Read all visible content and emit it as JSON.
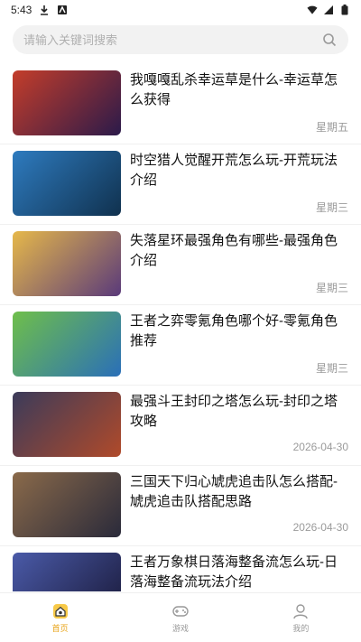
{
  "status_bar": {
    "time": "5:43"
  },
  "search": {
    "placeholder": "请输入关键词搜索"
  },
  "articles": [
    {
      "title": "我嘎嘎乱杀幸运草是什么-幸运草怎么获得",
      "date": "星期五",
      "thumb_label": "",
      "thumb_colors": [
        "#c43d2a",
        "#2b1a4a"
      ]
    },
    {
      "title": "时空猎人觉醒开荒怎么玩-开荒玩法介绍",
      "date": "星期三",
      "thumb_label": "",
      "thumb_colors": [
        "#2e7bbf",
        "#10314e"
      ]
    },
    {
      "title": "失落星环最强角色有哪些-最强角色介绍",
      "date": "星期三",
      "thumb_label": "",
      "thumb_colors": [
        "#e6b84a",
        "#5a3a7a"
      ]
    },
    {
      "title": "王者之弈零氪角色哪个好-零氪角色推荐",
      "date": "星期三",
      "thumb_label": "",
      "thumb_colors": [
        "#6fbf4a",
        "#2a6fb8"
      ]
    },
    {
      "title": "最强斗王封印之塔怎么玩-封印之塔攻略",
      "date": "2026-04-30",
      "thumb_label": "",
      "thumb_colors": [
        "#3b3b5a",
        "#b04a2a"
      ]
    },
    {
      "title": "三国天下归心虓虎追击队怎么搭配-虓虎追击队搭配思路",
      "date": "2026-04-30",
      "thumb_label": "",
      "thumb_colors": [
        "#8a6a4a",
        "#2a2a3a"
      ]
    },
    {
      "title": "王者万象棋日落海整备流怎么玩-日落海整备流玩法介绍",
      "date": "",
      "thumb_label": "",
      "thumb_colors": [
        "#4a5aa8",
        "#1a1a3a"
      ]
    }
  ],
  "bottom_nav": [
    {
      "label": "首页",
      "icon": "home-icon",
      "active": true
    },
    {
      "label": "游戏",
      "icon": "gamepad-icon",
      "active": false
    },
    {
      "label": "我的",
      "icon": "user-icon",
      "active": false
    }
  ],
  "colors": {
    "accent": "#e8a317"
  }
}
